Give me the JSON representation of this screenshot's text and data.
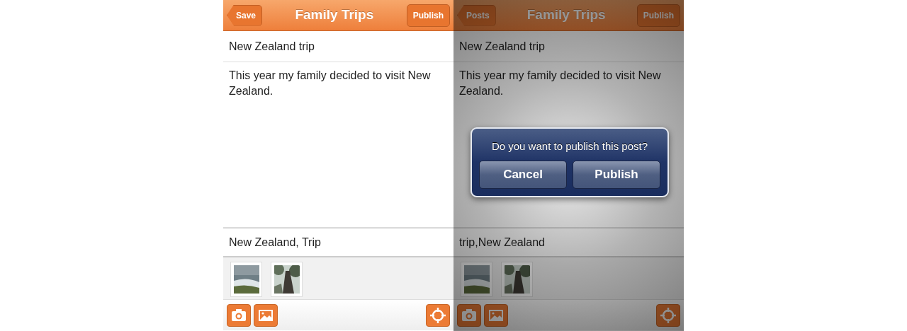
{
  "screens": [
    {
      "dimmed": false,
      "nav": {
        "back_button": "Save",
        "title": "Family Trips",
        "action_button": "Publish"
      },
      "post_title": "New Zealand trip",
      "body": "This year my family decided to visit New Zealand.",
      "tags": "New Zealand, Trip"
    },
    {
      "dimmed": true,
      "nav": {
        "back_button": "Posts",
        "title": "Family Trips",
        "action_button": "Publish"
      },
      "post_title": "New Zealand trip",
      "body": "This year my family decided to visit New Zealand.",
      "tags": "trip,New Zealand",
      "alert": {
        "message": "Do you want to publish this post?",
        "buttons": [
          "Cancel",
          "Publish"
        ]
      }
    }
  ]
}
